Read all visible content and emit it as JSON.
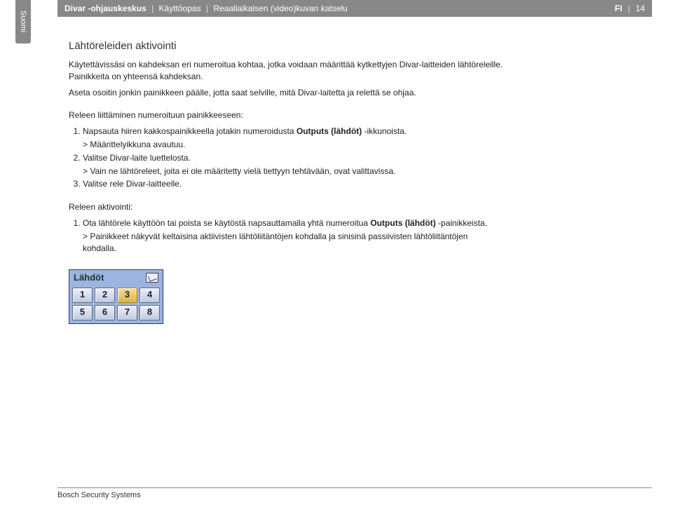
{
  "side_tab": "Suomi",
  "header": {
    "product": "Divar -ohjauskeskus",
    "doc": "Käyttöopas",
    "section": "Reaaliaikaisen (video)kuvan katselu",
    "lang": "FI",
    "page": "14"
  },
  "h2": "Lähtöreleiden aktivointi",
  "intro1": "Käytettävissäsi on kahdeksan eri numeroitua kohtaa, jotka voidaan määrittää kytkettyjen Divar-laitteiden lähtöreleille. Painikkeita on yhteensä kahdeksan.",
  "intro2": "Aseta osoitin jonkin painikkeen päälle, jotta saat selville, mitä Divar-laitetta ja relettä se ohjaa.",
  "sec1_head": "Releen liittäminen numeroituun painikkeeseen:",
  "s1_1a": "Napsauta hiiren kakkospainikkeella jotakin numeroidusta ",
  "s1_1b": "Outputs (lähdöt)",
  "s1_1c": " -ikkunoista.",
  "s1_1sub": "> Määrittelyikkuna avautuu.",
  "s1_2": "Valitse Divar-laite luettelosta.",
  "s1_2sub": "> Vain ne lähtöreleet, joita ei ole määritetty vielä tiettyyn tehtävään, ovat valittavissa.",
  "s1_3": "Valitse rele Divar-laitteelle.",
  "sec2_head": "Releen aktivointi:",
  "s2_1a": "Ota lähtörele käyttöön tai poista se käytöstä napsauttamalla yhtä numeroitua ",
  "s2_1b": "Outputs (lähdöt)",
  "s2_1c": " -painikkeista.",
  "s2_1sub": "> Painikkeet näkyvät keltaisina aktiivisten lähtöliitäntöjen kohdalla ja sinisinä passiivisten lähtöliitäntöjen kohdalla.",
  "panel": {
    "title": "Lähdöt",
    "buttons": [
      "1",
      "2",
      "3",
      "4",
      "5",
      "6",
      "7",
      "8"
    ],
    "selected": "3"
  },
  "footer": "Bosch Security Systems"
}
